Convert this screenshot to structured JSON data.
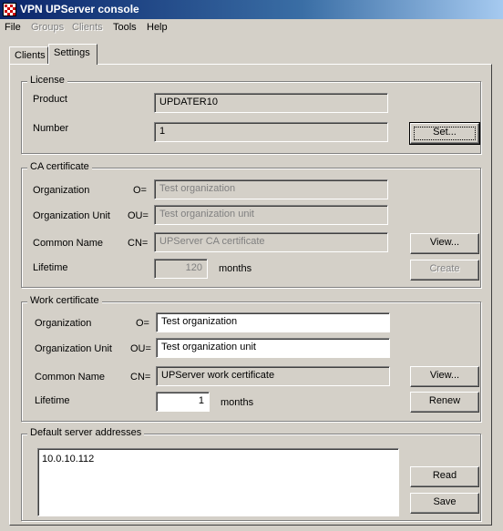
{
  "window": {
    "title": "VPN UPServer console"
  },
  "menu": {
    "file": "File",
    "groups": "Groups",
    "clients": "Clients",
    "tools": "Tools",
    "help": "Help"
  },
  "tabs": {
    "clients": "Clients",
    "settings": "Settings",
    "active": "Settings"
  },
  "license": {
    "title": "License",
    "product_label": "Product",
    "product_value": "UPDATER10",
    "number_label": "Number",
    "number_value": "1",
    "set_button": "Set..."
  },
  "ca_certificate": {
    "title": "CA certificate",
    "org_label": "Organization",
    "org_prefix": "O=",
    "org_value": "Test organization",
    "ou_label": "Organization Unit",
    "ou_prefix": "OU=",
    "ou_value": "Test organization unit",
    "cn_label": "Common Name",
    "cn_prefix": "CN=",
    "cn_value": "UPServer CA certificate",
    "lifetime_label": "Lifetime",
    "lifetime_value": "120",
    "lifetime_unit": "months",
    "view_button": "View...",
    "create_button": "Create"
  },
  "work_certificate": {
    "title": "Work certificate",
    "org_label": "Organization",
    "org_prefix": "O=",
    "org_value": "Test organization",
    "ou_label": "Organization Unit",
    "ou_prefix": "OU=",
    "ou_value": "Test organization unit",
    "cn_label": "Common Name",
    "cn_prefix": "CN=",
    "cn_value": "UPServer work certificate",
    "lifetime_label": "Lifetime",
    "lifetime_value": "1",
    "lifetime_unit": "months",
    "view_button": "View...",
    "renew_button": "Renew"
  },
  "addresses": {
    "title": "Default server addresses",
    "value": "10.0.10.112",
    "read_button": "Read",
    "save_button": "Save"
  }
}
